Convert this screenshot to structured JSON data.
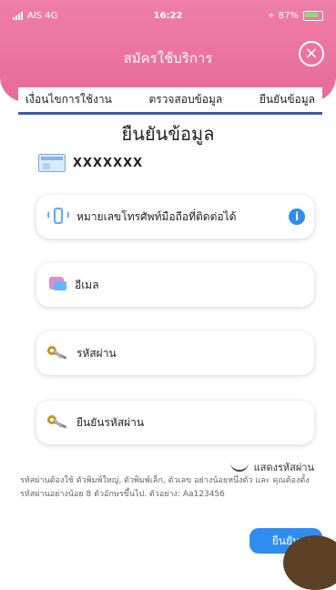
{
  "status_bar": {
    "carrier": "AIS 4G",
    "time": "16:22",
    "battery": "87%"
  },
  "header": {
    "title": "สมัครใช้บริการ"
  },
  "tabs": [
    {
      "label": "เงื่อนไขการใช้งาน"
    },
    {
      "label": "ตรวจสอบข้อมูล"
    },
    {
      "label": "ยืนยันข้อมูล"
    }
  ],
  "section": {
    "title": "ยืนยันข้อมูล"
  },
  "id_card": {
    "value": "XXXXXXX"
  },
  "fields": {
    "phone": {
      "label": "หมายเลขโทรศัพท์มือถือที่ติดต่อได้"
    },
    "email": {
      "label": "อีเมล"
    },
    "password": {
      "label": "รหัสผ่าน"
    },
    "confirm_password": {
      "label": "ยืนยันรหัสผ่าน"
    }
  },
  "show_password": {
    "label": "แสดงรหัสผ่าน"
  },
  "password_help": "รหัสผ่านต้องใช้ ตัวพิมพ์ใหญ่, ตัวพิมพ์เล็ก, ตัวเลข อย่างน้อยหนึ่งตัว และ คุณต้องตั้งรหัสผ่านอย่างน้อย 8 ตัวอักษรขึ้นไป. ตัวอย่าง: Aa123456",
  "confirm_button": {
    "label": "ยืนยัน"
  },
  "colors": {
    "header_pink": "#e86a98",
    "accent_blue": "#2f8df0",
    "tab_underline": "#3d5ba9"
  }
}
